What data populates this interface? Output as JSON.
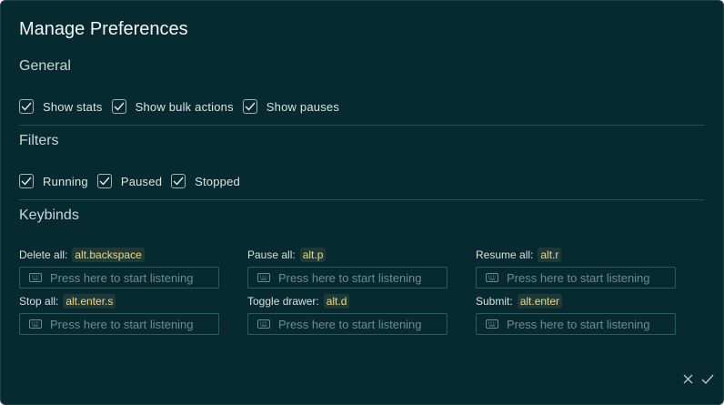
{
  "dialog": {
    "title": "Manage Preferences"
  },
  "general": {
    "title": "General",
    "options": [
      {
        "label": "Show stats",
        "checked": true
      },
      {
        "label": "Show bulk actions",
        "checked": true
      },
      {
        "label": "Show pauses",
        "checked": true
      }
    ]
  },
  "filters": {
    "title": "Filters",
    "options": [
      {
        "label": "Running",
        "checked": true
      },
      {
        "label": "Paused",
        "checked": true
      },
      {
        "label": "Stopped",
        "checked": true
      }
    ]
  },
  "keybinds": {
    "title": "Keybinds",
    "placeholder": "Press here to start listening",
    "items": [
      {
        "label": "Delete all:",
        "key": "alt.backspace"
      },
      {
        "label": "Pause all:",
        "key": "alt.p"
      },
      {
        "label": "Resume all:",
        "key": "alt.r"
      },
      {
        "label": "Stop all:",
        "key": "alt.enter.s"
      },
      {
        "label": "Toggle drawer:",
        "key": "alt.d"
      },
      {
        "label": "Submit:",
        "key": "alt.enter"
      }
    ]
  },
  "footer": {
    "cancel_icon": "close-icon",
    "confirm_icon": "check-icon"
  },
  "colors": {
    "background": "#062a30",
    "key_highlight": "#ebd78a",
    "divider": "#2a4c53"
  }
}
